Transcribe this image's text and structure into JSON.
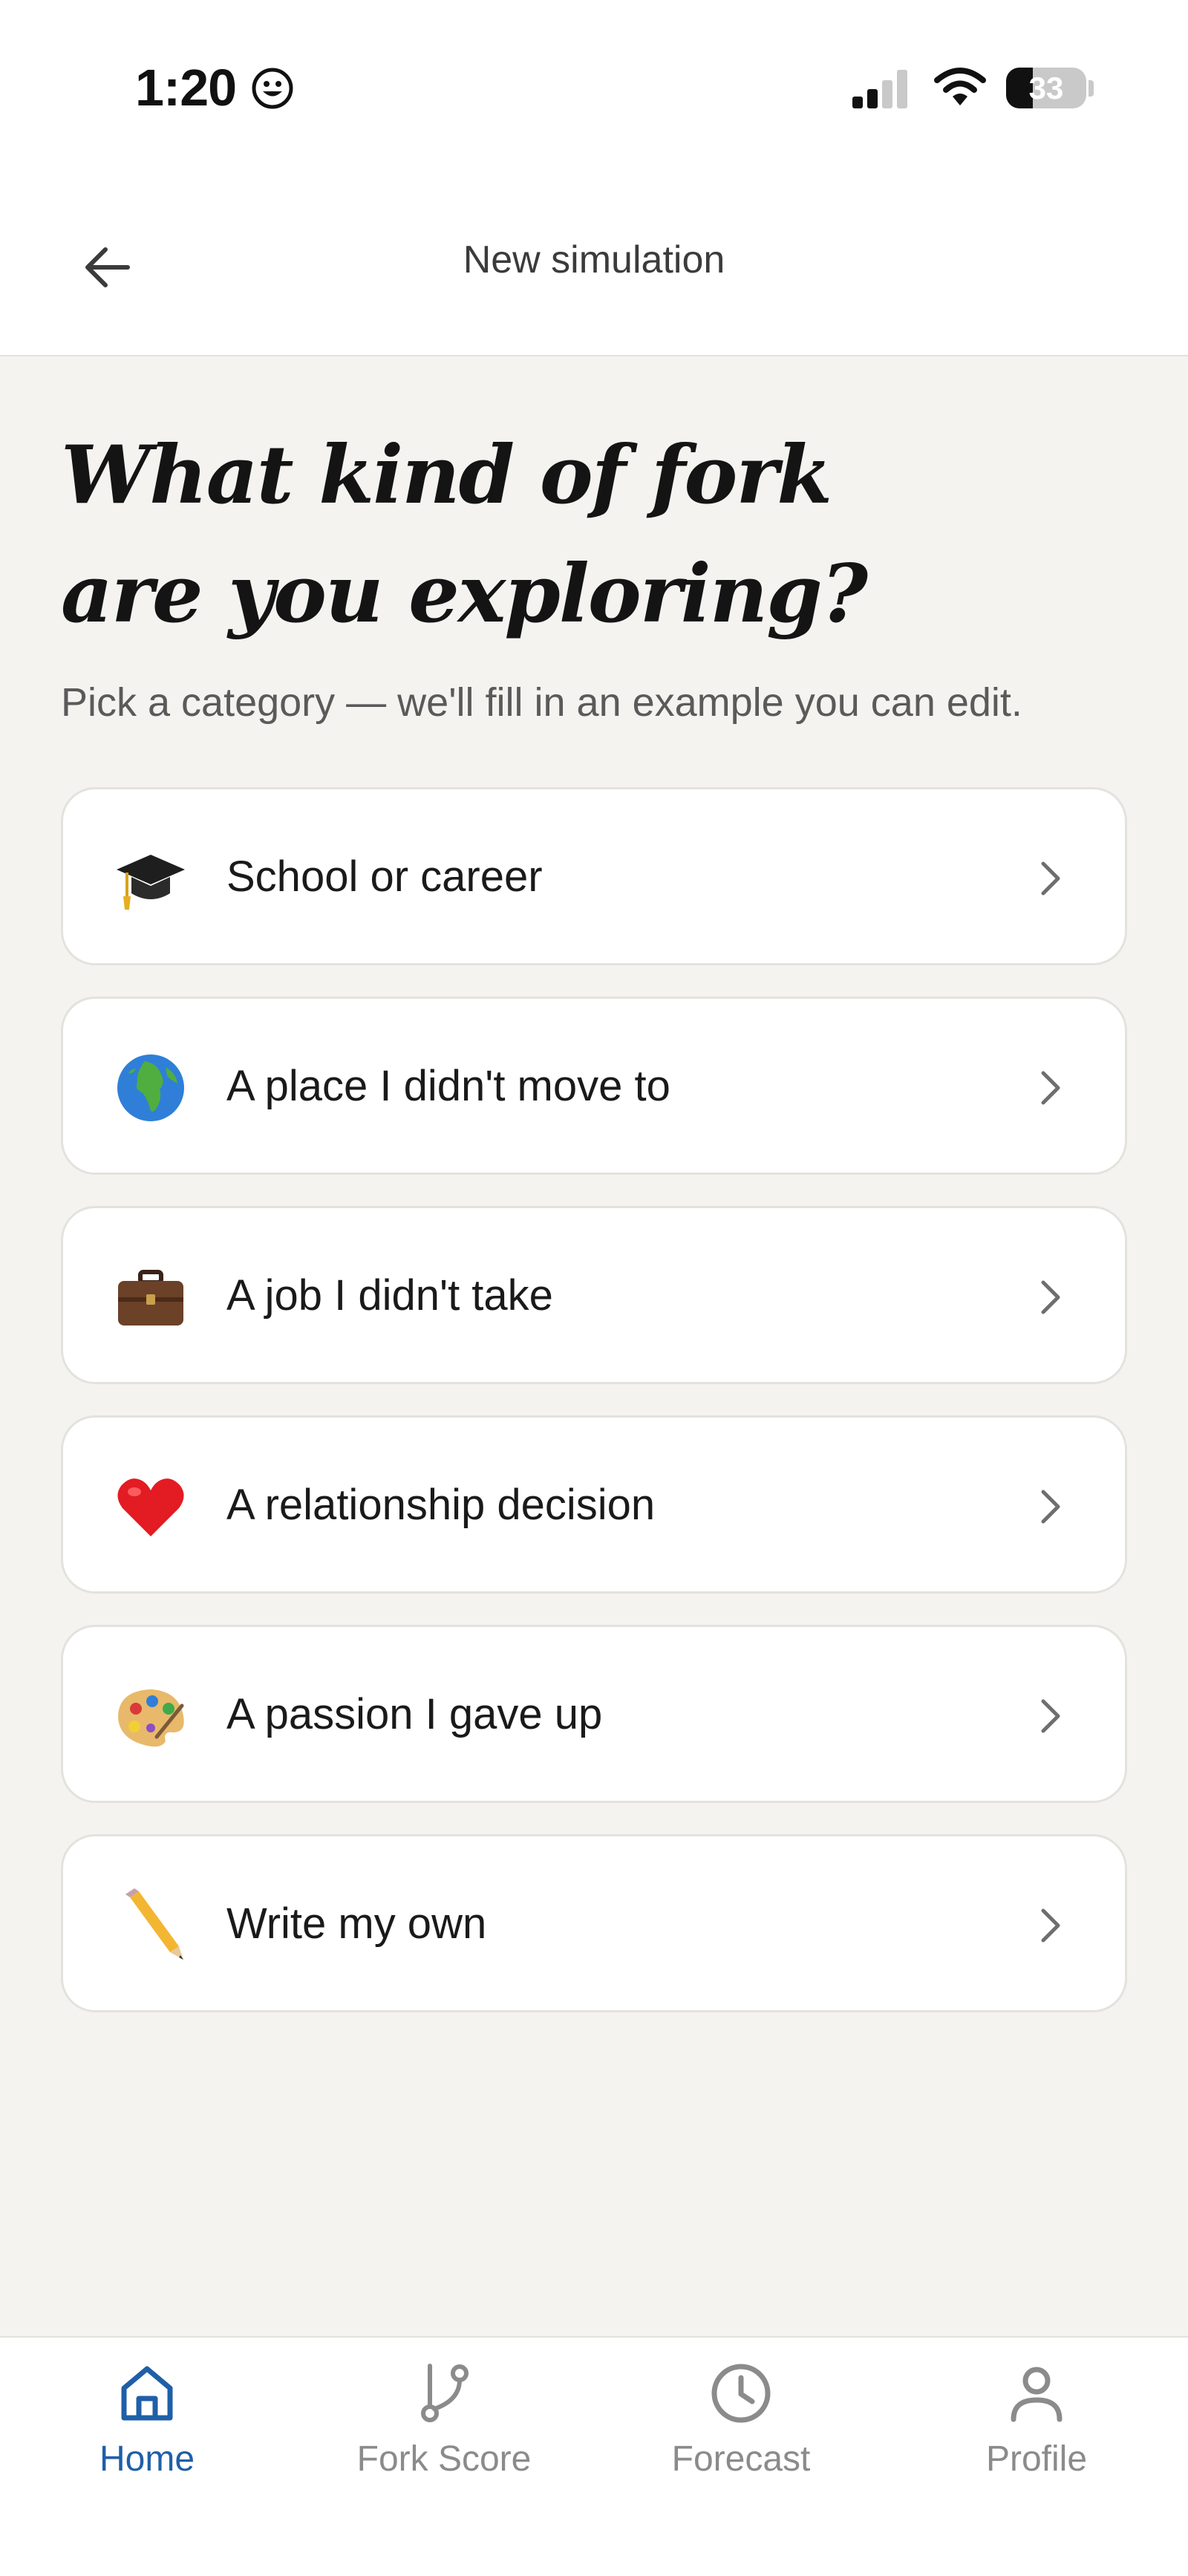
{
  "status_bar": {
    "time": "1:20",
    "battery_percent": "33",
    "battery_level": 0.33
  },
  "header": {
    "title": "New simulation",
    "back_icon": "arrow-left-icon"
  },
  "main": {
    "headline_line1": "What kind of fork",
    "headline_line2": "are you exploring?",
    "subtitle": "Pick a category — we'll fill in an example you can edit.",
    "options": [
      {
        "label": "School or career",
        "icon": "graduation-cap-icon"
      },
      {
        "label": "A place I didn't move to",
        "icon": "globe-icon"
      },
      {
        "label": "A job I didn't take",
        "icon": "briefcase-icon"
      },
      {
        "label": "A relationship decision",
        "icon": "heart-icon"
      },
      {
        "label": "A passion I gave up",
        "icon": "palette-icon"
      },
      {
        "label": "Write my own",
        "icon": "pencil-icon"
      }
    ]
  },
  "bottom_nav": {
    "items": [
      {
        "label": "Home",
        "icon": "home-icon",
        "active": true
      },
      {
        "label": "Fork Score",
        "icon": "fork-icon",
        "active": false
      },
      {
        "label": "Forecast",
        "icon": "clock-icon",
        "active": false
      },
      {
        "label": "Profile",
        "icon": "person-icon",
        "active": false
      }
    ]
  },
  "colors": {
    "accent": "#1f5fa8",
    "background": "#f4f3f0",
    "card": "#ffffff",
    "inactive_nav": "#8b8b8b"
  }
}
